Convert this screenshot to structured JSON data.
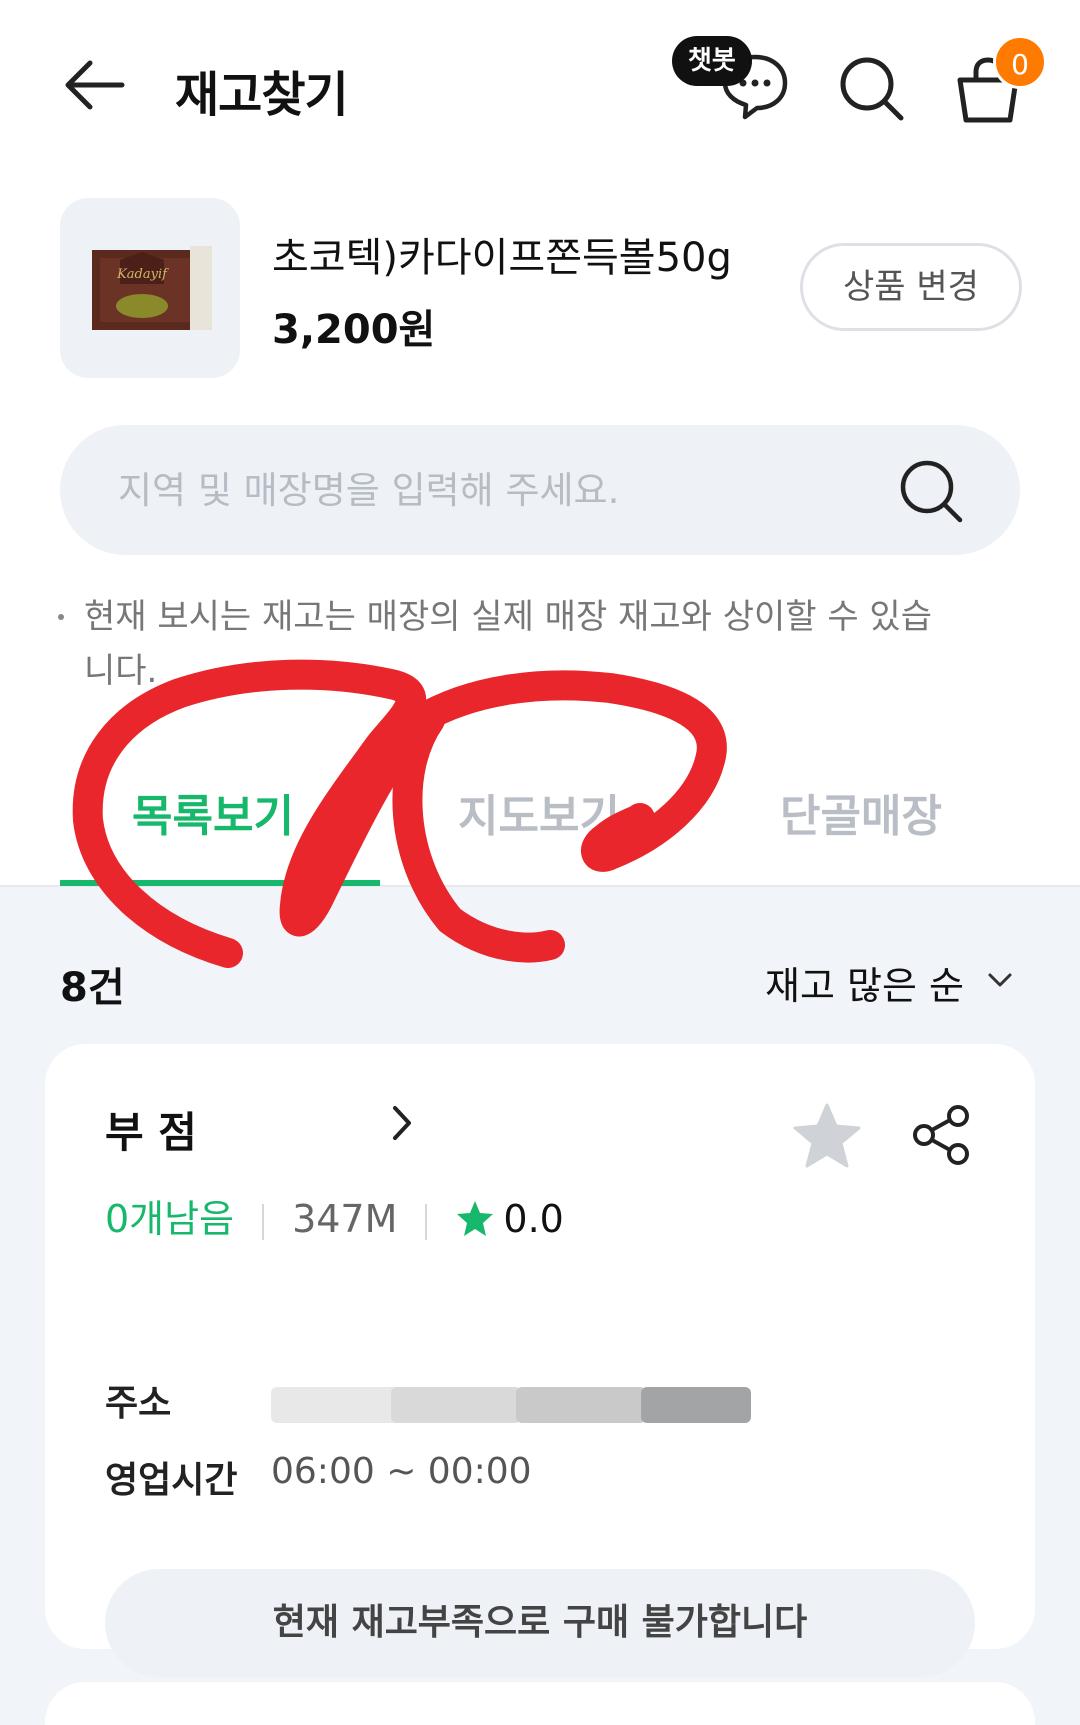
{
  "header": {
    "title": "재고찾기",
    "chatbot_badge": "챗봇",
    "cart_count": "0"
  },
  "product": {
    "name": "초코텍)카다이프쫀득볼50g",
    "price": "3,200원",
    "change_label": "상품 변경",
    "thumb_brand": "Kadayif"
  },
  "search": {
    "placeholder": "지역 및 매장명을 입력해 주세요."
  },
  "notice": "현재 보시는 재고는 매장의 실제 매장 재고와 상이할 수 있습니다.",
  "tabs": [
    {
      "label": "목록보기",
      "active": true
    },
    {
      "label": "지도보기",
      "active": false
    },
    {
      "label": "단골매장",
      "active": false
    }
  ],
  "list": {
    "count": "8건",
    "sort_label": "재고 많은 순",
    "stores": [
      {
        "name": "부        점",
        "stock": "0개남음",
        "distance": "347M",
        "rating": "0.0",
        "address_label": "주소",
        "hours_label": "영업시간",
        "hours": "06:00 ~ 00:00",
        "buy_label": "현재 재고부족으로 구매 불가합니다"
      }
    ]
  },
  "colors": {
    "accent": "#17b86b",
    "badge": "#ff7a00",
    "annotation": "#e8262b"
  }
}
